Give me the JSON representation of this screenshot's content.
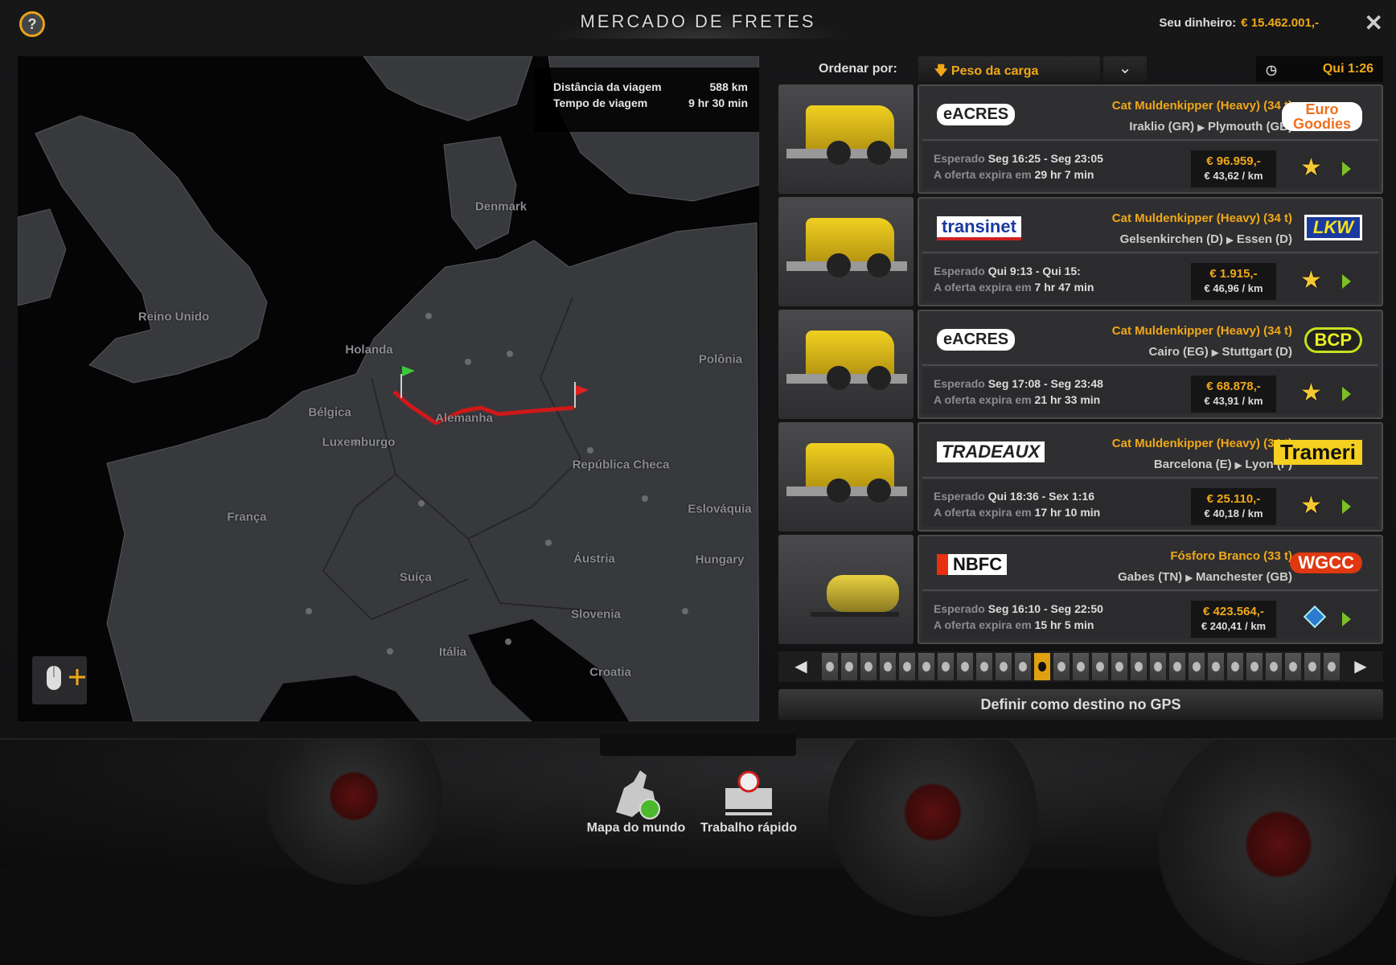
{
  "header": {
    "title": "MERCADO DE FRETES",
    "money_label": "Seu dinheiro:",
    "money_value": "€ 15.462.001,-",
    "help": "?",
    "close": "✕"
  },
  "map": {
    "trip_distance_label": "Distância da viagem",
    "trip_distance": "588 km",
    "trip_time_label": "Tempo de viagem",
    "trip_time": "9 hr 30 min",
    "labels": [
      "Denmark",
      "Reino Unido",
      "Holanda",
      "Polônia",
      "Bélgica",
      "Alemanha",
      "Luxemburgo",
      "República Checa",
      "França",
      "Eslováquia",
      "Áustria",
      "Hungary",
      "Suíça",
      "Slovenia",
      "Itália",
      "Croatia"
    ]
  },
  "sort": {
    "label": "Ordenar por:",
    "value": "Peso da carga",
    "arrow": "🡇",
    "dropdown": "⌄"
  },
  "clock": {
    "icon": "◷",
    "time": "Qui 1:26"
  },
  "jobs": [
    {
      "cargo": "Cat Muldenkipper (Heavy) (34 t)",
      "from": "Iraklio (GR)",
      "to": "Plymouth (GB)",
      "route_sep": "▶",
      "source": "eACRES",
      "dest": "Euro Goodies",
      "exp_label": "Esperado",
      "exp_time": "Seg 16:25 - Seg 23:05",
      "offer_label": "A oferta expira em",
      "offer_time": "29 hr 7 min",
      "price": "€ 96.959,-",
      "per_km": "€ 43,62 / km",
      "mark": "star"
    },
    {
      "cargo": "Cat Muldenkipper (Heavy) (34 t)",
      "from": "Gelsenkirchen (D)",
      "to": "Essen (D)",
      "route_sep": "▶",
      "source": "transinet",
      "dest": "LKW",
      "exp_label": "Esperado",
      "exp_time": "Qui 9:13 - Qui 15:",
      "offer_label": "A oferta expira em",
      "offer_time": "7 hr 47 min",
      "price": "€ 1.915,-",
      "per_km": "€ 46,96 / km",
      "mark": "star"
    },
    {
      "cargo": "Cat Muldenkipper (Heavy) (34 t)",
      "from": "Cairo (EG)",
      "to": "Stuttgart (D)",
      "route_sep": "▶",
      "source": "eACRES",
      "dest": "BCP",
      "exp_label": "Esperado",
      "exp_time": "Seg 17:08 - Seg 23:48",
      "offer_label": "A oferta expira em",
      "offer_time": "21 hr 33 min",
      "price": "€ 68.878,-",
      "per_km": "€ 43,91 / km",
      "mark": "star"
    },
    {
      "cargo": "Cat Muldenkipper (Heavy) (34 t)",
      "from": "Barcelona (E)",
      "to": "Lyon (F)",
      "route_sep": "▶",
      "source": "TRADEAUX",
      "dest": "Trameri",
      "exp_label": "Esperado",
      "exp_time": "Qui 18:36 - Sex 1:16",
      "offer_label": "A oferta expira em",
      "offer_time": "17 hr 10 min",
      "price": "€ 25.110,-",
      "per_km": "€ 40,18 / km",
      "mark": "star"
    },
    {
      "cargo": "Fósforo Branco (33 t)",
      "from": "Gabes (TN)",
      "to": "Manchester (GB)",
      "route_sep": "▶",
      "source": "NBFC",
      "dest": "WGCC",
      "exp_label": "Esperado",
      "exp_time": "Seg 16:10 - Seg 22:50",
      "offer_label": "A oferta expira em",
      "offer_time": "15 hr 5 min",
      "price": "€ 423.564,-",
      "per_km": "€ 240,41 / km",
      "mark": "hazard"
    }
  ],
  "pager": {
    "pages": 27,
    "current": 12,
    "prev": "◀",
    "next": "▶"
  },
  "gps_button": "Definir como destino no GPS",
  "bottom": {
    "world_map": "Mapa do mundo",
    "quick_job": "Trabalho rápido"
  },
  "colors": {
    "accent": "#f0a818",
    "route": "#d01818",
    "land": "#38393d"
  }
}
